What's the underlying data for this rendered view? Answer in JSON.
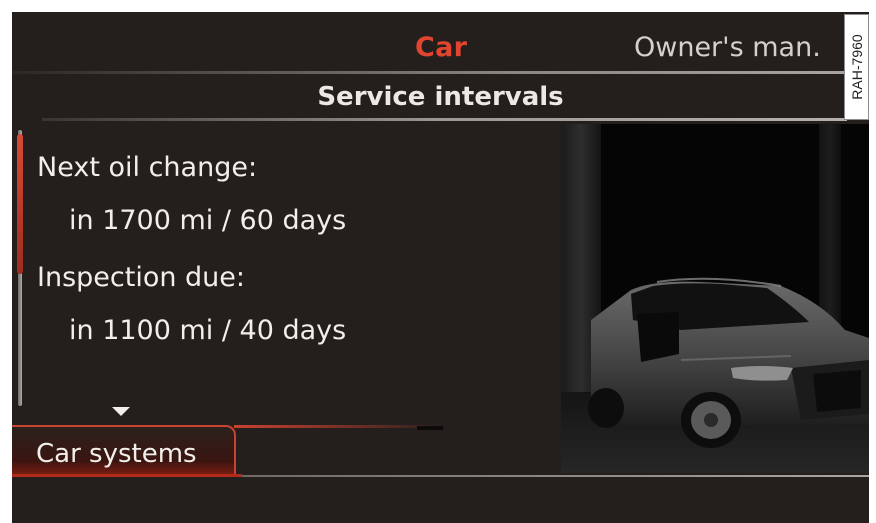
{
  "header": {
    "active_tab": "Car",
    "secondary_tab": "Owner's man.",
    "title": "Service intervals",
    "reference_code": "RAH-7960"
  },
  "service": {
    "oil_label": "Next oil change:",
    "oil_value": "in 1700 mi / 60 days",
    "inspection_label": "Inspection due:",
    "inspection_value": "in 1100 mi / 40 days"
  },
  "footer": {
    "tab_label": "Car systems"
  },
  "icons": {
    "scroll_down": "down-arrow-icon"
  },
  "colors": {
    "accent": "#e2452f",
    "background": "#241f1c",
    "text": "#f1efeb"
  }
}
